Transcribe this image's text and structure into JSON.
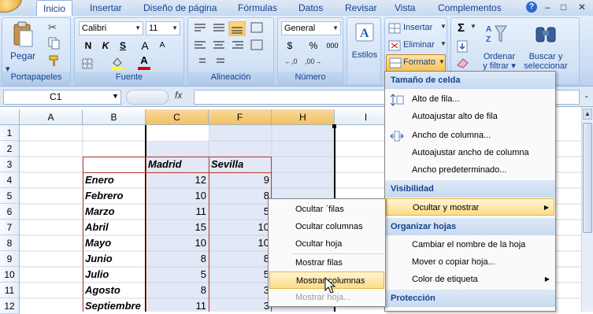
{
  "tabs": [
    "Inicio",
    "Insertar",
    "Diseño de página",
    "Fórmulas",
    "Datos",
    "Revisar",
    "Vista",
    "Complementos"
  ],
  "window_controls": {
    "help": "?",
    "minimize": "–",
    "restore": "□",
    "close": "✕"
  },
  "clipboard": {
    "paste_label": "Pegar",
    "group_label": "Portapapeles"
  },
  "font": {
    "name": "Calibri",
    "size": "11",
    "bold": "N",
    "italic": "K",
    "underline": "S",
    "grow": "A",
    "shrink": "A",
    "fill": "A",
    "color": "A",
    "group_label": "Fuente"
  },
  "alignment": {
    "group_label": "Alineación"
  },
  "number": {
    "format": "General",
    "currency": "$",
    "percent": "%",
    "thousands": "000",
    "group_label": "Número"
  },
  "styles": {
    "label": "Estilos"
  },
  "cells": {
    "insert_label": "Insertar",
    "delete_label": "Eliminar",
    "format_label": "Formato"
  },
  "editing": {
    "sum": "Σ",
    "sort_label_1": "Ordenar",
    "sort_label_2": "y filtrar",
    "find_label_1": "Buscar y",
    "find_label_2": "seleccionar"
  },
  "formula_bar": {
    "name_box": "C1",
    "fx": "fx",
    "value": ""
  },
  "columns": [
    "A",
    "B",
    "C",
    "F",
    "H",
    "I"
  ],
  "rows": [
    "1",
    "2",
    "3",
    "4",
    "5",
    "6",
    "7",
    "8",
    "9",
    "10",
    "11",
    "12"
  ],
  "table": {
    "header": [
      "Madrid",
      "Sevilla"
    ],
    "months": [
      "Enero",
      "Febrero",
      "Marzo",
      "Abril",
      "Mayo",
      "Junio",
      "Julio",
      "Agosto",
      "Septiembre"
    ],
    "madrid": [
      "12",
      "10",
      "11",
      "15",
      "10",
      "8",
      "5",
      "8",
      "11"
    ],
    "sevilla": [
      "9",
      "8",
      "5",
      "10",
      "10",
      "8",
      "5",
      "3",
      "3"
    ]
  },
  "format_menu": {
    "section_size": "Tamaño de celda",
    "row_height": "Alto de fila...",
    "autofit_row": "Autoajustar alto de fila",
    "col_width": "Ancho de columna...",
    "autofit_col": "Autoajustar ancho de columna",
    "default_width": "Ancho predeterminado...",
    "section_visibility": "Visibilidad",
    "hide_show": "Ocultar y mostrar",
    "section_sheets": "Organizar hojas",
    "rename": "Cambiar el nombre de la hoja",
    "move_copy": "Mover o copiar hoja...",
    "tab_color": "Color de etiqueta",
    "section_protection": "Protección"
  },
  "hide_menu": {
    "hide_rows": "Ocultar `filas",
    "hide_cols": "Ocultar columnas",
    "hide_sheet": "Ocultar hoja",
    "show_rows": "Mostrar filas",
    "show_cols": "Mostrar columnas",
    "show_sheet": "Mostrar hoja..."
  },
  "colors": {
    "ribbon": "#c9dcf3",
    "accent": "#15428b",
    "highlight": "#fddc89",
    "selection": "#e1e8f5",
    "table_border": "#c0392b"
  }
}
